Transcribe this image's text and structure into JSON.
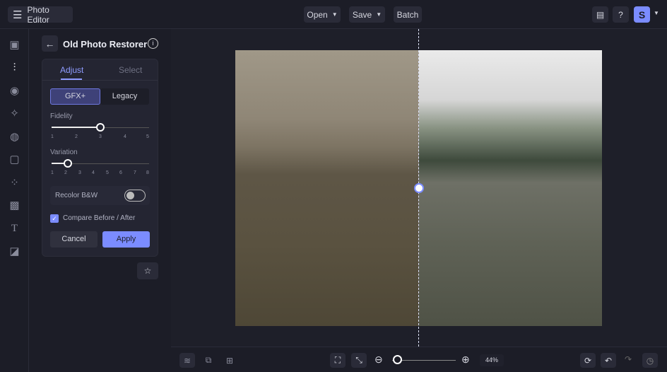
{
  "app": {
    "title": "Photo Editor",
    "avatar": "S"
  },
  "menu": {
    "open": "Open",
    "save": "Save",
    "batch": "Batch"
  },
  "tool": {
    "title": "Old Photo Restorer",
    "tabs": [
      "Adjust",
      "Select"
    ],
    "modes": [
      "GFX+",
      "Legacy"
    ],
    "fidelity": {
      "label": "Fidelity",
      "ticks": [
        "1",
        "2",
        "3",
        "4",
        "5"
      ],
      "value": 3
    },
    "variation": {
      "label": "Variation",
      "ticks": [
        "1",
        "2",
        "3",
        "4",
        "5",
        "6",
        "7",
        "8"
      ],
      "value": 2
    },
    "recolor_label": "Recolor B&W",
    "recolor_on": false,
    "compare_label": "Compare Before / After",
    "compare_checked": true,
    "cancel": "Cancel",
    "apply": "Apply"
  },
  "zoom": {
    "value": "44%",
    "slider_fraction": 0.1
  },
  "colors": {
    "accent": "#7b8cff",
    "bg": "#1c1d27"
  }
}
